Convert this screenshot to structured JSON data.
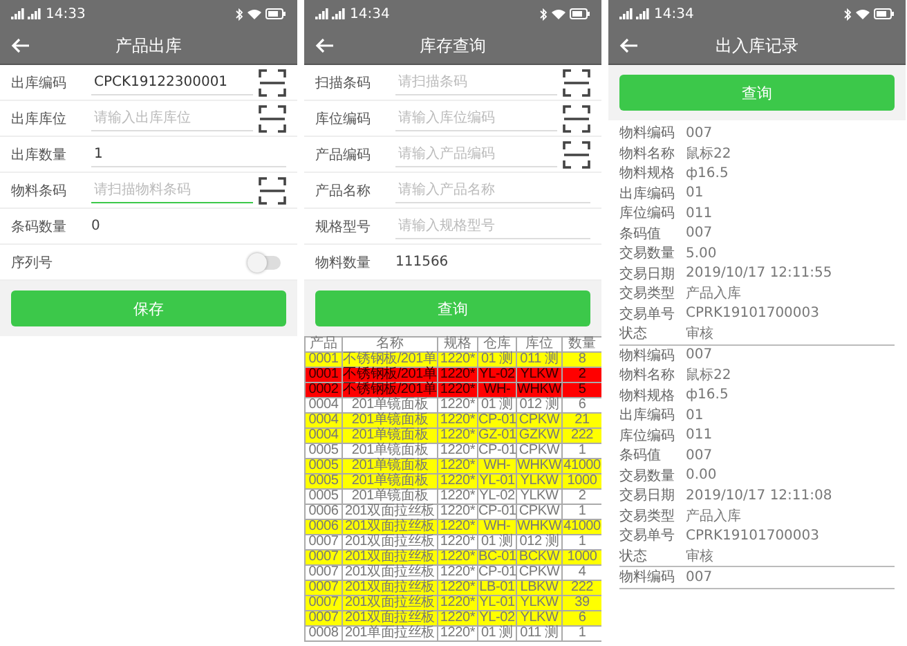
{
  "screens": [
    {
      "kind": "form",
      "status_bar": {
        "time": "14:33"
      },
      "title": "产品出库",
      "fields": [
        {
          "kind": "input",
          "label": "出库编码",
          "value": "CPCK19122300001",
          "scan": true,
          "focused": false
        },
        {
          "kind": "input",
          "label": "出库库位",
          "placeholder": "请输入出库库位",
          "scan": true,
          "focused": false
        },
        {
          "kind": "input",
          "label": "出库数量",
          "value": "1",
          "scan": false,
          "focused": false
        },
        {
          "kind": "input",
          "label": "物料条码",
          "placeholder": "请扫描物料条码",
          "scan": true,
          "focused": true
        },
        {
          "kind": "text",
          "label": "条码数量",
          "value": "0"
        },
        {
          "kind": "toggle",
          "label": "序列号",
          "on": false
        }
      ],
      "button": "保存"
    },
    {
      "kind": "query",
      "status_bar": {
        "time": "14:34"
      },
      "title": "库存查询",
      "fields": [
        {
          "kind": "input",
          "label": "扫描条码",
          "placeholder": "请扫描条码",
          "scan": true,
          "focused": false
        },
        {
          "kind": "input",
          "label": "库位编码",
          "placeholder": "请输入库位编码",
          "scan": true,
          "focused": false
        },
        {
          "kind": "input",
          "label": "产品编码",
          "placeholder": "请输入产品编码",
          "scan": true,
          "focused": false
        },
        {
          "kind": "input",
          "label": "产品名称",
          "placeholder": "请输入产品名称",
          "scan": false,
          "focused": false
        },
        {
          "kind": "input",
          "label": "规格型号",
          "placeholder": "请输入规格型号",
          "scan": false,
          "focused": false
        },
        {
          "kind": "text",
          "label": "物料数量",
          "value": "111566"
        }
      ],
      "button": "查询",
      "table": {
        "columns": [
          "产品",
          "名称",
          "规格",
          "仓库",
          "库位",
          "数量"
        ],
        "rows": [
          {
            "color": "#ffff00",
            "cells": [
              "0001",
              "不锈钢板/201单",
              "1220*",
              "01 测",
              "011 测",
              "8"
            ]
          },
          {
            "color": "#ff0000",
            "cells": [
              "0001",
              "不锈钢板/201单",
              "1220*",
              "YL-02",
              "YLKW",
              "2"
            ]
          },
          {
            "color": "#ff0000",
            "cells": [
              "0002",
              "不锈钢板/201单",
              "1220*",
              "WH-",
              "WHKW",
              "5"
            ]
          },
          {
            "color": "#ffffff",
            "cells": [
              "0004",
              "201单镜面板",
              "1220*",
              "01 测",
              "012 测",
              "6"
            ]
          },
          {
            "color": "#ffff00",
            "cells": [
              "0004",
              "201单镜面板",
              "1220*",
              "CP-01",
              "CPKW",
              "21"
            ]
          },
          {
            "color": "#ffff00",
            "cells": [
              "0004",
              "201单镜面板",
              "1220*",
              "GZ-01",
              "GZKW",
              "222"
            ]
          },
          {
            "color": "#ffffff",
            "cells": [
              "0005",
              "201单镜面板",
              "1220*",
              "CP-01",
              "CPKW",
              "1"
            ]
          },
          {
            "color": "#ffff00",
            "cells": [
              "0005",
              "201单镜面板",
              "1220*",
              "WH-",
              "WHKW",
              "41000"
            ]
          },
          {
            "color": "#ffff00",
            "cells": [
              "0005",
              "201单镜面板",
              "1220*",
              "YL-01",
              "YLKW",
              "1000"
            ]
          },
          {
            "color": "#ffffff",
            "cells": [
              "0005",
              "201单镜面板",
              "1220*",
              "YL-02",
              "YLKW",
              "2"
            ]
          },
          {
            "color": "#ffffff",
            "cells": [
              "0006",
              "201双面拉丝板",
              "1220*",
              "CP-01",
              "CPKW",
              "1"
            ]
          },
          {
            "color": "#ffff00",
            "cells": [
              "0006",
              "201双面拉丝板",
              "1220*",
              "WH-",
              "WHKW",
              "41000"
            ]
          },
          {
            "color": "#ffffff",
            "cells": [
              "0007",
              "201双面拉丝板",
              "1220*",
              "01 测",
              "012 测",
              "1"
            ]
          },
          {
            "color": "#ffff00",
            "cells": [
              "0007",
              "201双面拉丝板",
              "1220*",
              "BC-01",
              "BCKW",
              "1000"
            ]
          },
          {
            "color": "#ffffff",
            "cells": [
              "0007",
              "201双面拉丝板",
              "1220*",
              "CP-01",
              "CPKW",
              "4"
            ]
          },
          {
            "color": "#ffff00",
            "cells": [
              "0007",
              "201双面拉丝板",
              "1220*",
              "LB-01",
              "LBKW",
              "222"
            ]
          },
          {
            "color": "#ffff00",
            "cells": [
              "0007",
              "201双面拉丝板",
              "1220*",
              "YL-01",
              "YLKW",
              "39"
            ]
          },
          {
            "color": "#ffff00",
            "cells": [
              "0007",
              "201双面拉丝板",
              "1220*",
              "YL-02",
              "YLKW",
              "6"
            ]
          },
          {
            "color": "#ffffff",
            "cells": [
              "0008",
              "201单面拉丝板",
              "1220*",
              "01 测",
              "011 测",
              "1"
            ]
          }
        ]
      }
    },
    {
      "kind": "records",
      "status_bar": {
        "time": "14:34"
      },
      "title": "出入库记录",
      "button": "查询",
      "records": [
        [
          {
            "label": "物料编码",
            "value": "007"
          },
          {
            "label": "物料名称",
            "value": "鼠标22"
          },
          {
            "label": "物料规格",
            "value": "ф16.5"
          },
          {
            "label": "出库编码",
            "value": "01"
          },
          {
            "label": "库位编码",
            "value": "011"
          },
          {
            "label": "条码值",
            "value": "007"
          },
          {
            "label": "交易数量",
            "value": "5.00"
          },
          {
            "label": "交易日期",
            "value": "2019/10/17 12:11:55"
          },
          {
            "label": "交易类型",
            "value": "产品入库"
          },
          {
            "label": "交易单号",
            "value": "CPRK19101700003"
          },
          {
            "label": "状态",
            "value": "审核"
          }
        ],
        [
          {
            "label": "物料编码",
            "value": "007"
          },
          {
            "label": "物料名称",
            "value": "鼠标22"
          },
          {
            "label": "物料规格",
            "value": "ф16.5"
          },
          {
            "label": "出库编码",
            "value": "01"
          },
          {
            "label": "库位编码",
            "value": "011"
          },
          {
            "label": "条码值",
            "value": "007"
          },
          {
            "label": "交易数量",
            "value": "0.00"
          },
          {
            "label": "交易日期",
            "value": "2019/10/17 12:11:08"
          },
          {
            "label": "交易类型",
            "value": "产品入库"
          },
          {
            "label": "交易单号",
            "value": "CPRK19101700003"
          },
          {
            "label": "状态",
            "value": "审核"
          }
        ],
        [
          {
            "label": "物料编码",
            "value": "007"
          }
        ]
      ]
    }
  ]
}
